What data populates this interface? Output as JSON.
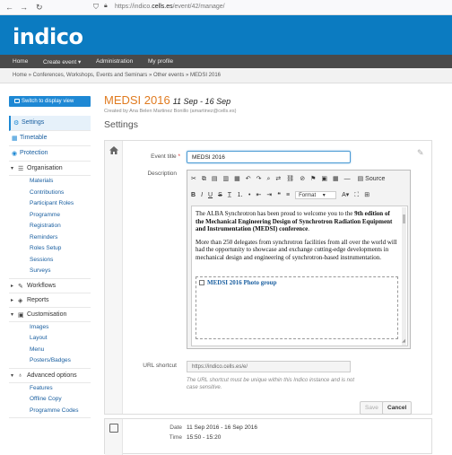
{
  "browser": {
    "url_prefix": "https://indico.",
    "url_domain": "cells.es",
    "url_path": "/event/42/manage/"
  },
  "header": {
    "logo": "indico"
  },
  "nav": {
    "items": [
      "Home",
      "Create event ▾",
      "Administration",
      "My profile"
    ]
  },
  "breadcrumb": "Home  »  Conferences, Workshops, Events and Seminars  »  Other events  »  MEDSI 2016",
  "sidebar": {
    "switch_label": "Switch to display view",
    "settings": "Settings",
    "timetable": "Timetable",
    "protection": "Protection",
    "organisation": "Organisation",
    "organisation_items": [
      "Materials",
      "Contributions",
      "Participant Roles",
      "Programme",
      "Registration",
      "Reminders",
      "Roles Setup",
      "Sessions",
      "Surveys"
    ],
    "workflows": "Workflows",
    "reports": "Reports",
    "customisation": "Customisation",
    "customisation_items": [
      "Images",
      "Layout",
      "Menu",
      "Posters/Badges"
    ],
    "advanced": "Advanced options",
    "advanced_items": [
      "Features",
      "Offline Copy",
      "Programme Codes"
    ]
  },
  "event": {
    "title": "MEDSI 2016",
    "dates": "11 Sep - 16 Sep",
    "created_by": "Created by Ana Belen Martinez Bonillo (amartinez@cells.es)"
  },
  "settings": {
    "heading": "Settings",
    "title_label": "Event title",
    "title_value": "MEDSI 2016",
    "description_label": "Description",
    "format_label": "Format",
    "source_label": "Source",
    "desc_p1_start": "The ALBA Synchrotron has been proud to welcome you to the ",
    "desc_p1_bold": "9th edition of the Mechanical Engineering Design of Synchrotron Radiation Equipment and Instrumentation (MEDSI) conference",
    "desc_p1_end": ".",
    "desc_p2": "More than 250 delegates from synchrotron facilities from all over the world will had the opportunity to showcase and exchange cutting-edge developments in mechanical design and engineering of synchrotron-based instrumentation.",
    "photo_link": "MEDSI 2016 Photo group",
    "url_label": "URL shortcut",
    "url_prefix": "https://indico.cells.es/e/",
    "url_note": "The URL shortcut must be unique within this Indico instance and is not case sensitive.",
    "save": "Save",
    "cancel": "Cancel"
  },
  "dates_card": {
    "date_label": "Date",
    "date_value": "11 Sep 2016 - 16 Sep 2016",
    "time_label": "Time",
    "time_value": "15:50 - 15:20"
  }
}
